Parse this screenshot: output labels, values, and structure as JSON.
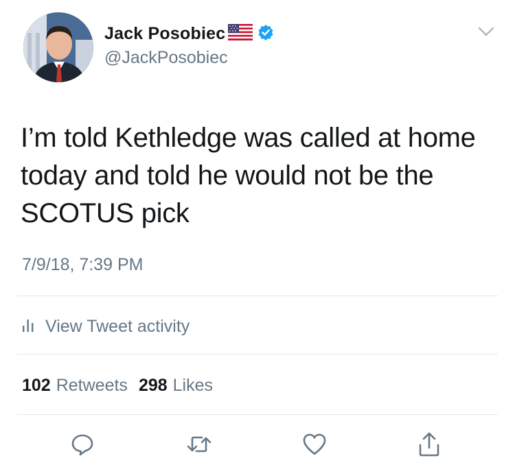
{
  "user": {
    "name": "Jack Posobiec",
    "handle": "@JackPosobiec",
    "flag_icon": "us-flag-emoji",
    "verified_icon": "verified-badge-icon"
  },
  "tweet": {
    "text": "I’m told Kethledge was called at home today and told he would not be the SCOTUS pick",
    "timestamp": "7/9/18, 7:39 PM"
  },
  "activity": {
    "label": "View Tweet activity",
    "icon": "bar-chart-icon"
  },
  "stats": {
    "retweets_count": "102",
    "retweets_label": "Retweets",
    "likes_count": "298",
    "likes_label": "Likes"
  },
  "actions": [
    "reply-icon",
    "retweet-icon",
    "like-icon",
    "share-icon"
  ],
  "colors": {
    "text": "#14171a",
    "secondary": "#657786",
    "divider": "#e1e8ed",
    "verified": "#1da1f2"
  }
}
